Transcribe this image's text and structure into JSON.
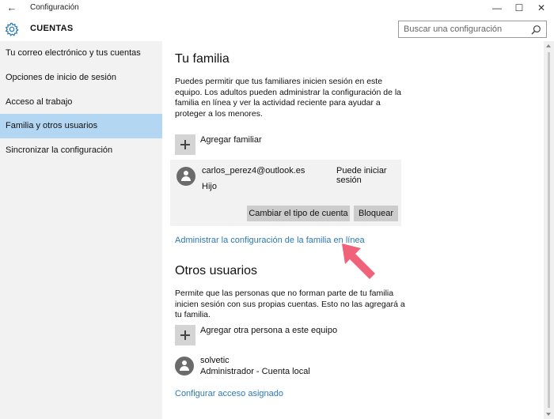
{
  "window": {
    "title": "Configuración",
    "back_glyph": "←",
    "minimize_glyph": "—",
    "maximize_glyph": "☐",
    "close_glyph": "✕"
  },
  "header": {
    "section": "CUENTAS",
    "search_placeholder": "Buscar una configuración",
    "icon": "gear-icon"
  },
  "sidebar": {
    "items": [
      {
        "label": "Tu correo electrónico y tus cuentas"
      },
      {
        "label": "Opciones de inicio de sesión"
      },
      {
        "label": "Acceso al trabajo"
      },
      {
        "label": "Familia y otros usuarios",
        "selected": true
      },
      {
        "label": "Sincronizar la configuración"
      }
    ]
  },
  "family": {
    "title": "Tu familia",
    "description": "Puedes permitir que tus familiares inicien sesión en este equipo. Los adultos pueden administrar la configuración de la familia en línea y ver la actividad reciente para ayudar a proteger a los menores.",
    "add_label": "Agregar familiar",
    "member": {
      "email": "carlos_perez4@outlook.es",
      "status": "Puede iniciar sesión",
      "role": "Hijo",
      "change_type_button": "Cambiar el tipo de cuenta",
      "block_button": "Bloquear"
    },
    "manage_link": "Administrar la configuración de la familia en línea"
  },
  "others": {
    "title": "Otros usuarios",
    "description": "Permite que las personas que no forman parte de tu familia inicien sesión con sus propias cuentas. Esto no las agregará a tu familia.",
    "add_label": "Agregar otra persona a este equipo",
    "user": {
      "name": "solvetic",
      "role": "Administrador - Cuenta local"
    },
    "assigned_access_link": "Configurar acceso asignado"
  },
  "colors": {
    "accent_link": "#2a7ab8",
    "selected_nav": "#b3d7f3",
    "arrow": "#f0627a"
  }
}
